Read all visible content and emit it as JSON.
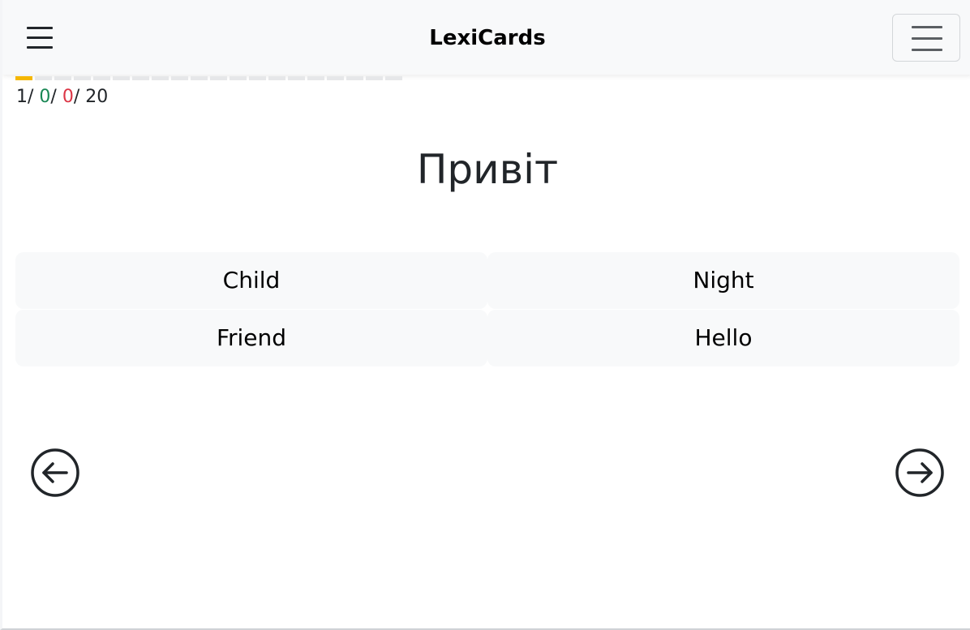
{
  "header": {
    "title": "LexiCards",
    "menu_icon": "hamburger-menu-icon",
    "toggler_icon": "navbar-toggler-icon"
  },
  "progress": {
    "current": 1,
    "correct": "0",
    "incorrect": "0",
    "total": "20",
    "counter_current": "1",
    "separator": "/ ",
    "colors": {
      "current_segment": "#f5b700",
      "pending_segment": "#e6e7e9",
      "correct": "#198754",
      "incorrect": "#dc3545"
    }
  },
  "card": {
    "word": "Привіт"
  },
  "options": [
    {
      "label": "Child"
    },
    {
      "label": "Night"
    },
    {
      "label": "Friend"
    },
    {
      "label": "Hello"
    }
  ],
  "navigation": {
    "prev_icon": "arrow-left-circle-icon",
    "next_icon": "arrow-right-circle-icon"
  }
}
